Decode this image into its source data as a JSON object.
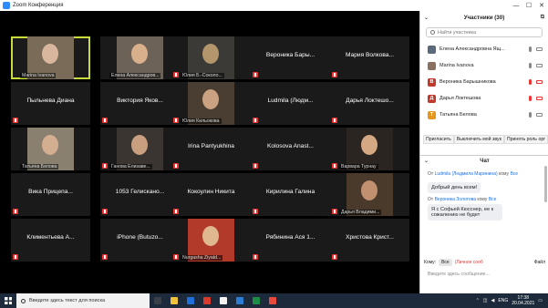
{
  "window": {
    "title": "Zoom Конференция",
    "controls": [
      "—",
      "☐",
      "✕"
    ]
  },
  "tiles": [
    {
      "name": "",
      "label": "Marina Ivanova",
      "photo": "#7a6a58",
      "face": "#d9b79e",
      "active": true,
      "mute": false
    },
    {
      "name": "",
      "label": "Елена Александров...",
      "photo": "#6c6258",
      "face": "#d8b08c",
      "mute": false
    },
    {
      "name": "",
      "label": "Юлия Б.-Соколо...",
      "photo": "#3b3a36",
      "face": "#b4966c",
      "mute": true
    },
    {
      "name": "Вероника  Бары...",
      "label": "",
      "mute": true
    },
    {
      "name": "Мария  Волкова...",
      "label": "",
      "mute": true
    },
    {
      "name": "Пыльнева Диана",
      "label": "",
      "mute": true
    },
    {
      "name": "Виктория  Яков...",
      "label": "",
      "mute": true
    },
    {
      "name": "",
      "label": "Юлия Кильокова",
      "photo": "#4a3d32",
      "face": "#caa282",
      "mute": true
    },
    {
      "name": "Ludmila  (Людм...",
      "label": "",
      "mute": true
    },
    {
      "name": "Дарья  Локтешо...",
      "label": "",
      "mute": true
    },
    {
      "name": "",
      "label": "Татьяна Белова",
      "photo": "#8a8070",
      "face": "#d4ae90",
      "mute": false
    },
    {
      "name": "",
      "label": "Ганова Елизаве...",
      "photo": "#3a3530",
      "face": "#c8a080",
      "mute": true
    },
    {
      "name": "Irina  Pantyukhina",
      "label": "",
      "mute": true
    },
    {
      "name": "Kolosova  Anast...",
      "label": "",
      "mute": true
    },
    {
      "name": "",
      "label": "Варвара Турнау",
      "photo": "#2a2520",
      "face": "#d4a882",
      "mute": true
    },
    {
      "name": "Вика  Прицепа...",
      "label": "",
      "mute": true
    },
    {
      "name": "1053  Гелискано...",
      "label": "",
      "mute": true
    },
    {
      "name": "Кокоулин Никита",
      "label": "",
      "mute": true
    },
    {
      "name": "Кирилина Галина",
      "label": "",
      "mute": true
    },
    {
      "name": "",
      "label": "Дарья Владими...",
      "photo": "#4a3a2c",
      "face": "#c09070",
      "mute": true
    },
    {
      "name": "Климентьева  А...",
      "label": "",
      "mute": true
    },
    {
      "name": "iPhone  (Butuzo...",
      "label": "",
      "mute": true
    },
    {
      "name": "",
      "label": "Nurgasha Ziyatd...",
      "photo": "#b23a2a",
      "face": "#e0b890",
      "mute": true
    },
    {
      "name": "Рябинина  Ася  1...",
      "label": "",
      "mute": true
    },
    {
      "name": "Христова  Крист...",
      "label": "",
      "mute": true
    }
  ],
  "participants": {
    "title": "Участники (30)",
    "search_placeholder": "Найти участника",
    "list": [
      {
        "name": "Елена Александровна Ящ...",
        "initial": "",
        "avatar_color": "#5a6a7a",
        "mic_color": "#888",
        "cam_color": "#888"
      },
      {
        "name": "Marina Ivanova",
        "initial": "",
        "avatar_color": "#8a7060",
        "mic_color": "#888",
        "cam_color": "#888"
      },
      {
        "name": "Вероника Барышникова",
        "initial": "В",
        "avatar_color": "#c0392b",
        "mic_color": "#e33",
        "cam_color": "#e33"
      },
      {
        "name": "Дарья Локтешова",
        "initial": "Д",
        "avatar_color": "#c0392b",
        "mic_color": "#e33",
        "cam_color": "#e33"
      },
      {
        "name": "Татьяна Белова",
        "initial": "Т",
        "avatar_color": "#e69520",
        "mic_color": "#888",
        "cam_color": "#888"
      }
    ],
    "buttons": [
      "Пригласить",
      "Выключить мой звук",
      "Принять роль орг"
    ]
  },
  "chat": {
    "title": "Чат",
    "messages": [
      {
        "from_label": "От",
        "from": "Ludmila (Людмила Маринина)",
        "to_label": "кому",
        "to": "Все",
        "text": "Добрый день всем!"
      },
      {
        "from_label": "От",
        "from": "Вероника Золотова",
        "to_label": "кому",
        "to": "Все",
        "text": "Я с Софьей Кюсснер, ее к сожалению не будет"
      }
    ],
    "to_label": "Кому:",
    "to_value": "Все",
    "private_label": "(Личное сооб",
    "file_label": "Файл",
    "input_placeholder": "Введите здесь сообщение..."
  },
  "taskbar": {
    "search_placeholder": "Введите здесь текст для поиска",
    "apps": [
      "#3a3f48",
      "#f0c23a",
      "#1e6fd8",
      "#d83b2b",
      "#f2f2f2",
      "#2b7cd3",
      "#1c8c46",
      "#e84b3a"
    ],
    "lang": "ENG",
    "time": "17:38",
    "date": "20.04.2021"
  }
}
